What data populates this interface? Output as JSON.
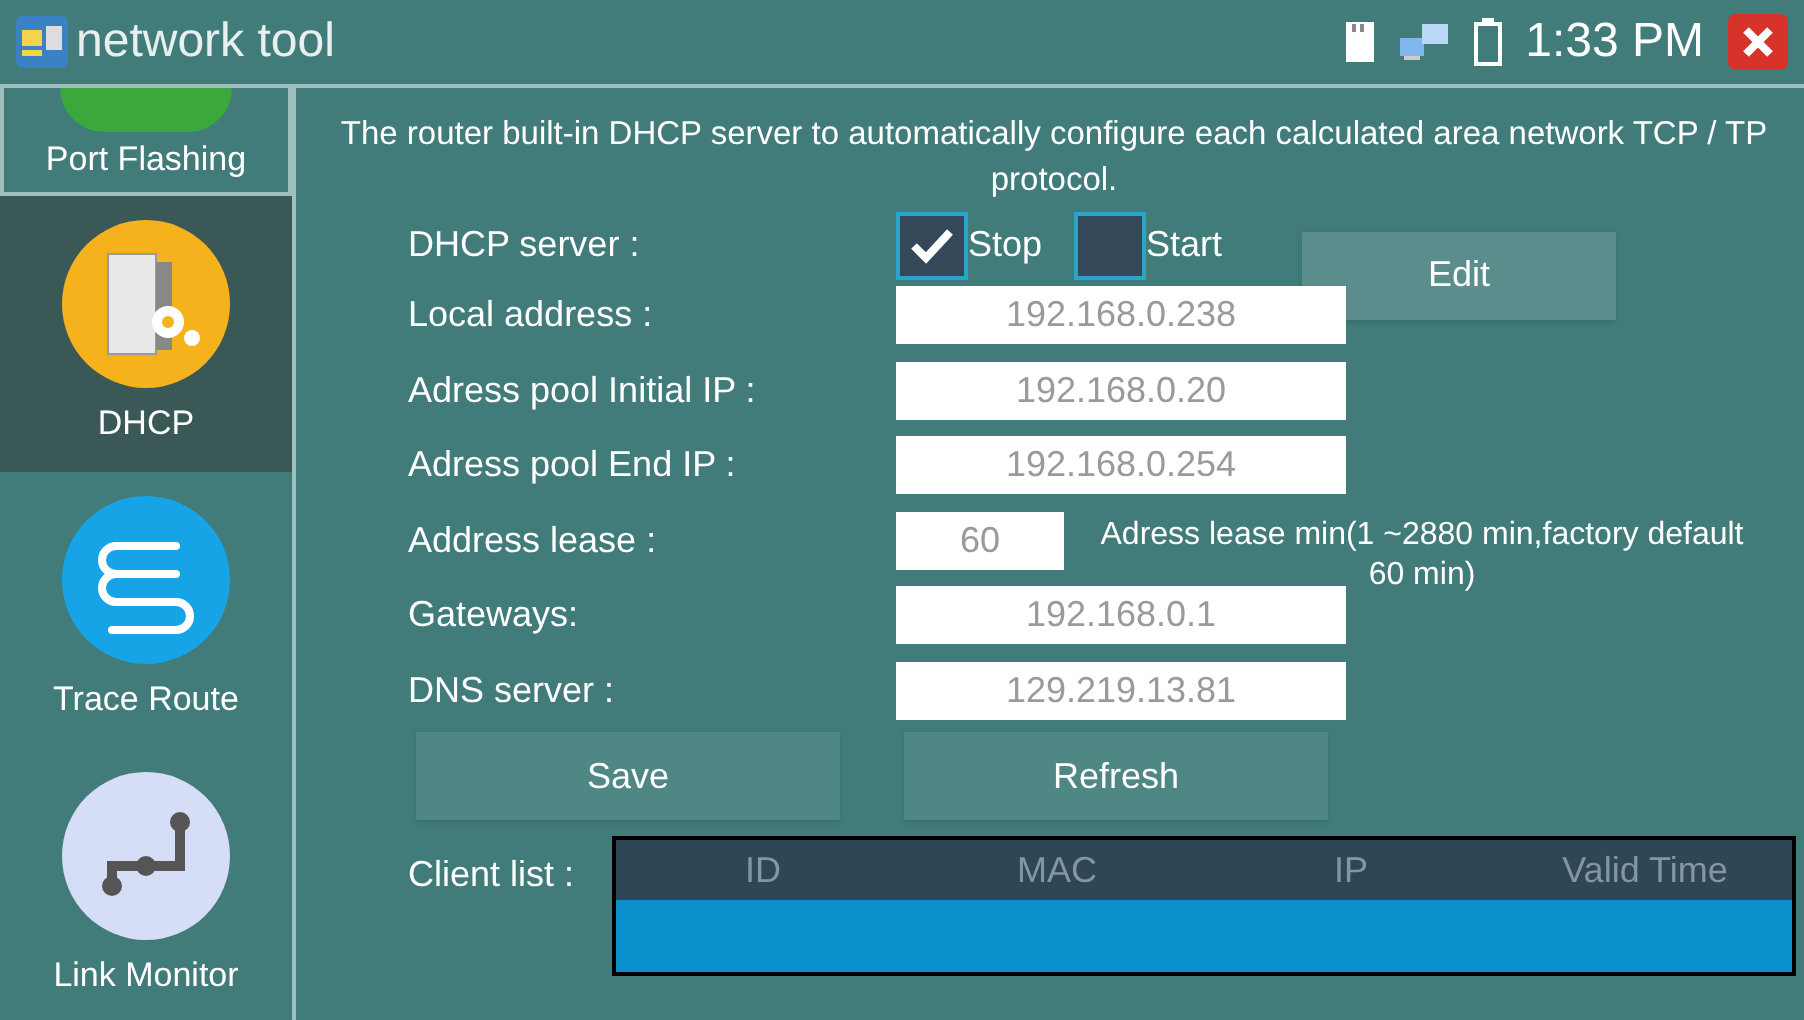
{
  "window": {
    "title": "network tool",
    "time": "1:33 PM"
  },
  "sidebar": {
    "items": [
      {
        "label": "Port Flashing",
        "kind": "green",
        "selected": false
      },
      {
        "label": "DHCP",
        "kind": "server",
        "selected": true
      },
      {
        "label": "Trace Route",
        "kind": "route",
        "selected": false
      },
      {
        "label": "Link Monitor",
        "kind": "link",
        "selected": false
      }
    ]
  },
  "description": "The router built-in DHCP server to automatically configure each calculated area network TCP / TP protocol.",
  "form": {
    "server_label": "DHCP server :",
    "options": [
      {
        "label": "Stop",
        "checked": true
      },
      {
        "label": "Start",
        "checked": false
      }
    ],
    "edit_button": "Edit",
    "fields": [
      {
        "label": "Local address :",
        "value": "192.168.0.238",
        "kind": "wide"
      },
      {
        "label": "Adress pool Initial IP :",
        "value": "192.168.0.20",
        "kind": "wide"
      },
      {
        "label": "Adress pool End IP :",
        "value": "192.168.0.254",
        "kind": "wide"
      },
      {
        "label": "Address lease :",
        "value": "60",
        "kind": "short",
        "hint": "Adress lease min(1 ~2880 min,factory default 60 min)"
      },
      {
        "label": "Gateways:",
        "value": "192.168.0.1",
        "kind": "wide"
      },
      {
        "label": "DNS server :",
        "value": "129.219.13.81",
        "kind": "wide"
      }
    ],
    "buttons": [
      "Save",
      "Refresh"
    ]
  },
  "client_list": {
    "label": "Client list :",
    "columns": [
      "ID",
      "MAC",
      "IP",
      "Valid Time"
    ]
  }
}
